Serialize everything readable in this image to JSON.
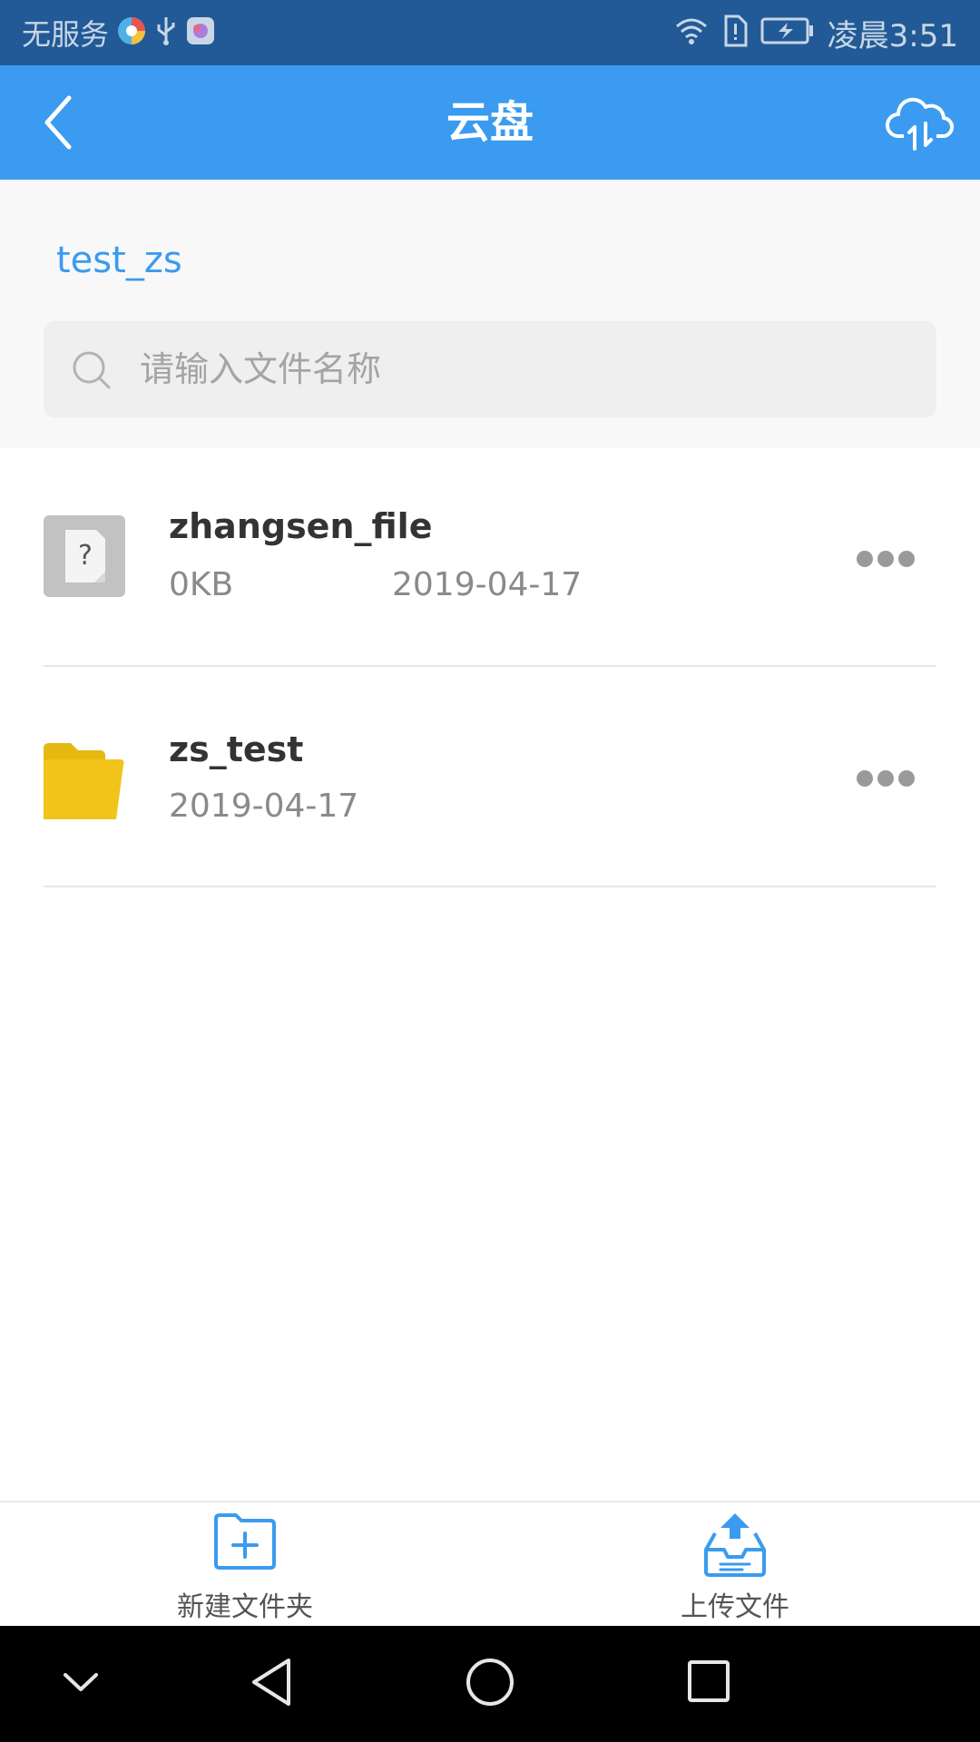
{
  "status_bar": {
    "carrier": "无服务",
    "time": "凌晨3:51",
    "icons": [
      "browser-icon",
      "usb-icon",
      "app-icon",
      "wifi-icon",
      "sim-alert-icon",
      "battery-charging-icon"
    ]
  },
  "app_bar": {
    "title": "云盘",
    "back_icon": "chevron-left-icon",
    "transfer_icon": "cloud-transfer-icon"
  },
  "breadcrumb": "test_zs",
  "search": {
    "placeholder": "请输入文件名称",
    "value": ""
  },
  "files": [
    {
      "name": "zhangsen_file",
      "size": "0KB",
      "date": "2019-04-17",
      "icon": "unknown-file-icon"
    },
    {
      "name": "zs_test",
      "date": "2019-04-17",
      "icon": "folder-icon"
    }
  ],
  "bottom_actions": [
    {
      "label": "新建文件夹",
      "icon": "new-folder-icon"
    },
    {
      "label": "上传文件",
      "icon": "upload-tray-icon"
    }
  ],
  "colors": {
    "status_bar": "#215a96",
    "app_bar": "#3a9bf0",
    "accent": "#3a9bf0",
    "folder": "#f0c419"
  }
}
